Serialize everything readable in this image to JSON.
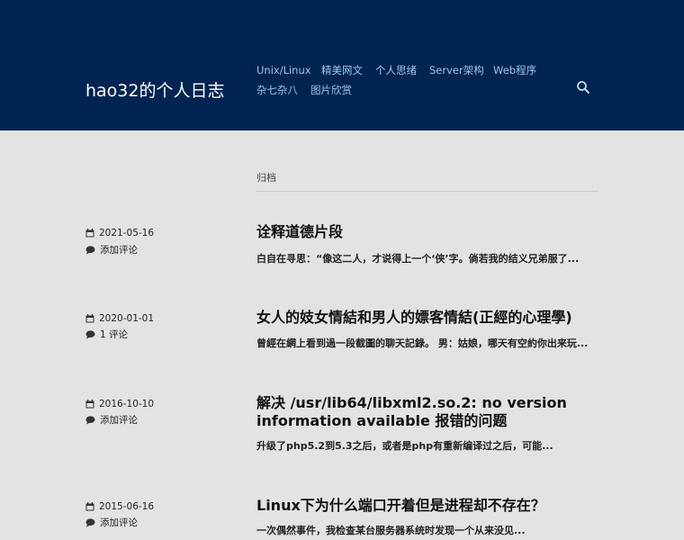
{
  "site": {
    "title": "hao32的个人日志"
  },
  "nav": {
    "items": [
      {
        "label": "Unix/Linux"
      },
      {
        "label": "精美网文"
      },
      {
        "label": "个人思绪"
      },
      {
        "label": "Server架构"
      },
      {
        "label": "Web程序"
      },
      {
        "label": "杂七杂八"
      },
      {
        "label": "图片欣赏"
      }
    ]
  },
  "archive": {
    "label": "归档"
  },
  "posts": [
    {
      "date": "2021-05-16",
      "comments": "添加评论",
      "title": "诠释道德片段",
      "excerpt": "白自在寻思：“像这二人，才说得上一个‘侠’字。倘若我的结义兄弟服了..."
    },
    {
      "date": "2020-01-01",
      "comments": "1 评论",
      "title": "女人的妓女情結和男人的嫖客情結(正經的心理學)",
      "excerpt": "曾經在網上看到過一段截圖的聊天記錄。 男：姑娘，哪天有空約你出来玩..."
    },
    {
      "date": "2016-10-10",
      "comments": "添加评论",
      "title": "解决 /usr/lib64/libxml2.so.2: no version information available 报错的问题",
      "excerpt": "升级了php5.2到5.3之后，或者是php有重新编译过之后，可能..."
    },
    {
      "date": "2015-06-16",
      "comments": "添加评论",
      "title": "Linux下为什么端口开着但是进程却不存在？",
      "excerpt": " 一次偶然事件，我检查某台服务器系统时发现一个从来没见..."
    }
  ]
}
